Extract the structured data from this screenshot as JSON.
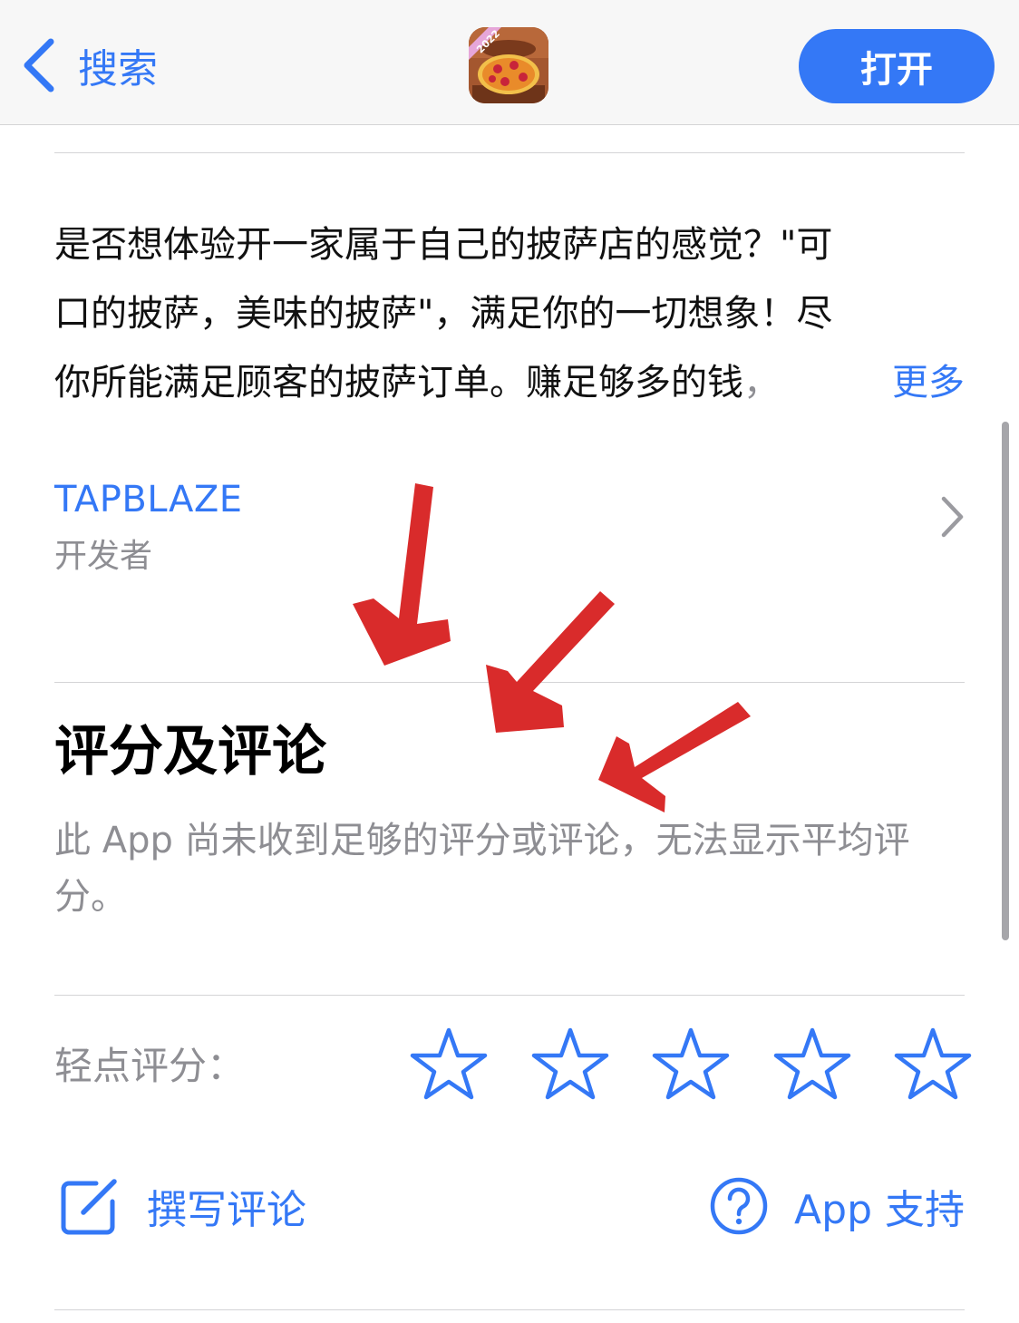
{
  "navbar": {
    "back_label": "搜索",
    "open_label": "打开",
    "app_icon_badge": "2022"
  },
  "description": {
    "lines": [
      "是否想体验开一家属于自己的披萨店的感觉？\"可",
      "口的披萨，美味的披萨\"，满足你的一切想象！尽",
      "你所能满足顾客的披萨订单。赚足够多的钱"
    ],
    "fade_tail": "，",
    "more_label": "更多"
  },
  "developer": {
    "name": "TAPBLAZE",
    "role": "开发者"
  },
  "ratings": {
    "title": "评分及评论",
    "no_ratings_text": "此 App 尚未收到足够的评分或评论，无法显示平均评分。",
    "tap_to_rate_label": "轻点评分：",
    "star_count": 5,
    "star_value": 0
  },
  "actions": {
    "write_review_label": "撰写评论",
    "app_support_label": "App 支持"
  },
  "colors": {
    "accent": "#3478f6",
    "secondary_text": "#8e8e93",
    "annotation_arrow": "#d92b2b"
  },
  "icons": [
    "chevron-left-icon",
    "app-icon",
    "chevron-right-icon",
    "star-icon",
    "compose-icon",
    "question-circle-icon",
    "red-arrow-annotation"
  ]
}
